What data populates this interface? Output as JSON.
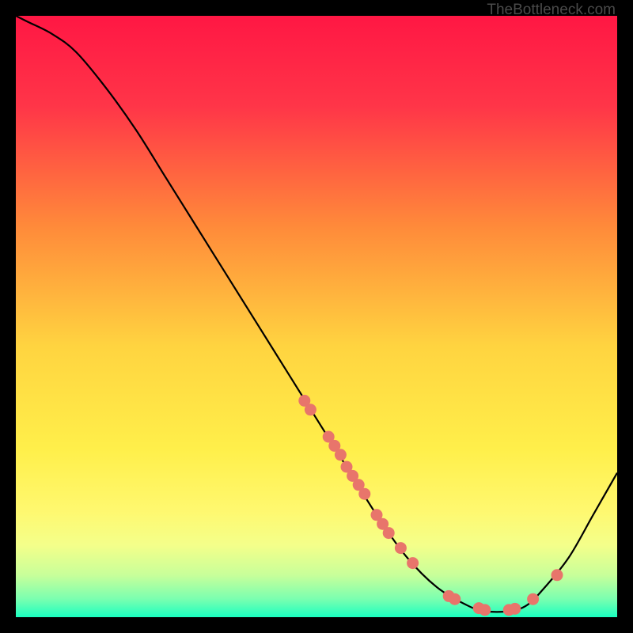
{
  "watermark": "TheBottleneck.com",
  "chart_data": {
    "type": "line",
    "title": "",
    "xlabel": "",
    "ylabel": "",
    "xlim": [
      0,
      100
    ],
    "ylim": [
      0,
      100
    ],
    "grid": false,
    "curve": [
      {
        "x": 0,
        "y": 100
      },
      {
        "x": 2,
        "y": 99
      },
      {
        "x": 6,
        "y": 97
      },
      {
        "x": 10,
        "y": 94
      },
      {
        "x": 15,
        "y": 88
      },
      {
        "x": 20,
        "y": 81
      },
      {
        "x": 25,
        "y": 73
      },
      {
        "x": 30,
        "y": 65
      },
      {
        "x": 35,
        "y": 57
      },
      {
        "x": 40,
        "y": 49
      },
      {
        "x": 45,
        "y": 41
      },
      {
        "x": 50,
        "y": 33
      },
      {
        "x": 55,
        "y": 25
      },
      {
        "x": 60,
        "y": 17
      },
      {
        "x": 65,
        "y": 10
      },
      {
        "x": 70,
        "y": 5
      },
      {
        "x": 75,
        "y": 2
      },
      {
        "x": 78,
        "y": 1
      },
      {
        "x": 82,
        "y": 1
      },
      {
        "x": 85,
        "y": 2
      },
      {
        "x": 88,
        "y": 5
      },
      {
        "x": 92,
        "y": 10
      },
      {
        "x": 96,
        "y": 17
      },
      {
        "x": 100,
        "y": 24
      }
    ],
    "markers": [
      {
        "x": 48,
        "y": 36
      },
      {
        "x": 49,
        "y": 34.5
      },
      {
        "x": 52,
        "y": 30
      },
      {
        "x": 53,
        "y": 28.5
      },
      {
        "x": 54,
        "y": 27
      },
      {
        "x": 55,
        "y": 25
      },
      {
        "x": 56,
        "y": 23.5
      },
      {
        "x": 57,
        "y": 22
      },
      {
        "x": 58,
        "y": 20.5
      },
      {
        "x": 60,
        "y": 17
      },
      {
        "x": 61,
        "y": 15.5
      },
      {
        "x": 62,
        "y": 14
      },
      {
        "x": 64,
        "y": 11.5
      },
      {
        "x": 66,
        "y": 9
      },
      {
        "x": 72,
        "y": 3.5
      },
      {
        "x": 73,
        "y": 3
      },
      {
        "x": 77,
        "y": 1.5
      },
      {
        "x": 78,
        "y": 1.2
      },
      {
        "x": 82,
        "y": 1.2
      },
      {
        "x": 83,
        "y": 1.4
      },
      {
        "x": 86,
        "y": 3
      },
      {
        "x": 90,
        "y": 7
      }
    ],
    "gradient_stops": [
      {
        "offset": 0,
        "color": "#ff1744"
      },
      {
        "offset": 0.15,
        "color": "#ff3548"
      },
      {
        "offset": 0.35,
        "color": "#ff8a3a"
      },
      {
        "offset": 0.55,
        "color": "#ffd440"
      },
      {
        "offset": 0.72,
        "color": "#ffef4a"
      },
      {
        "offset": 0.82,
        "color": "#fff86e"
      },
      {
        "offset": 0.88,
        "color": "#f4ff8a"
      },
      {
        "offset": 0.93,
        "color": "#c8ff9a"
      },
      {
        "offset": 0.97,
        "color": "#7affb0"
      },
      {
        "offset": 1.0,
        "color": "#1affc0"
      }
    ],
    "marker_color": "#e8756b",
    "curve_color": "#000000"
  }
}
